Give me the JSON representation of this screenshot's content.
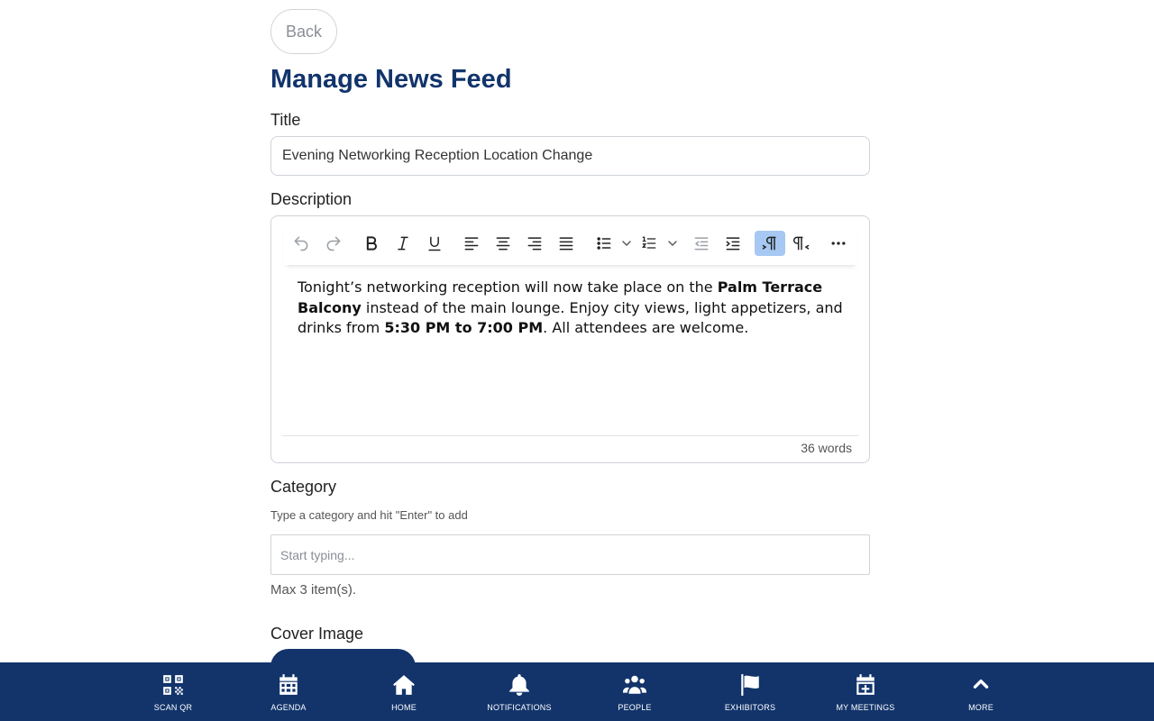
{
  "back_label": "Back",
  "page_title": "Manage News Feed",
  "title_field": {
    "label": "Title",
    "value": "Evening Networking Reception Location Change"
  },
  "description_field": {
    "label": "Description",
    "body": {
      "part1": "Tonight’s networking reception will now take place on the ",
      "bold1": "Palm Terrace Balcony",
      "part2": " instead of the main lounge. Enjoy city views, light appetizers, and drinks from ",
      "bold2": "5:30 PM to 7:00 PM",
      "part3": ". All attendees are welcome."
    },
    "word_count": "36 words",
    "toolbar_icons": [
      "undo-icon",
      "redo-icon",
      "bold-icon",
      "italic-icon",
      "underline-icon",
      "align-left-icon",
      "align-center-icon",
      "align-right-icon",
      "align-justify-icon",
      "bullet-list-icon",
      "numbered-list-icon",
      "outdent-icon",
      "indent-icon",
      "ltr-icon",
      "rtl-icon",
      "more-icon"
    ],
    "active_color": "#a6c8f2"
  },
  "category_field": {
    "label": "Category",
    "hint": "Type a category and hit \"Enter\" to add",
    "placeholder": "Start typing...",
    "max_note": "Max 3 item(s)."
  },
  "cover_image": {
    "label": "Cover Image"
  },
  "bottom_nav": {
    "color": "#12346b",
    "items": [
      {
        "label": "SCAN QR",
        "icon": "qr-code-icon"
      },
      {
        "label": "AGENDA",
        "icon": "calendar-icon"
      },
      {
        "label": "HOME",
        "icon": "home-icon"
      },
      {
        "label": "NOTIFICATIONS",
        "icon": "bell-icon"
      },
      {
        "label": "PEOPLE",
        "icon": "people-icon"
      },
      {
        "label": "EXHIBITORS",
        "icon": "flag-icon"
      },
      {
        "label": "MY MEETINGS",
        "icon": "calendar-plus-icon"
      },
      {
        "label": "MORE",
        "icon": "chevron-up-icon"
      }
    ]
  },
  "colors": {
    "brand": "#12346b",
    "border": "#cfd3d8"
  }
}
